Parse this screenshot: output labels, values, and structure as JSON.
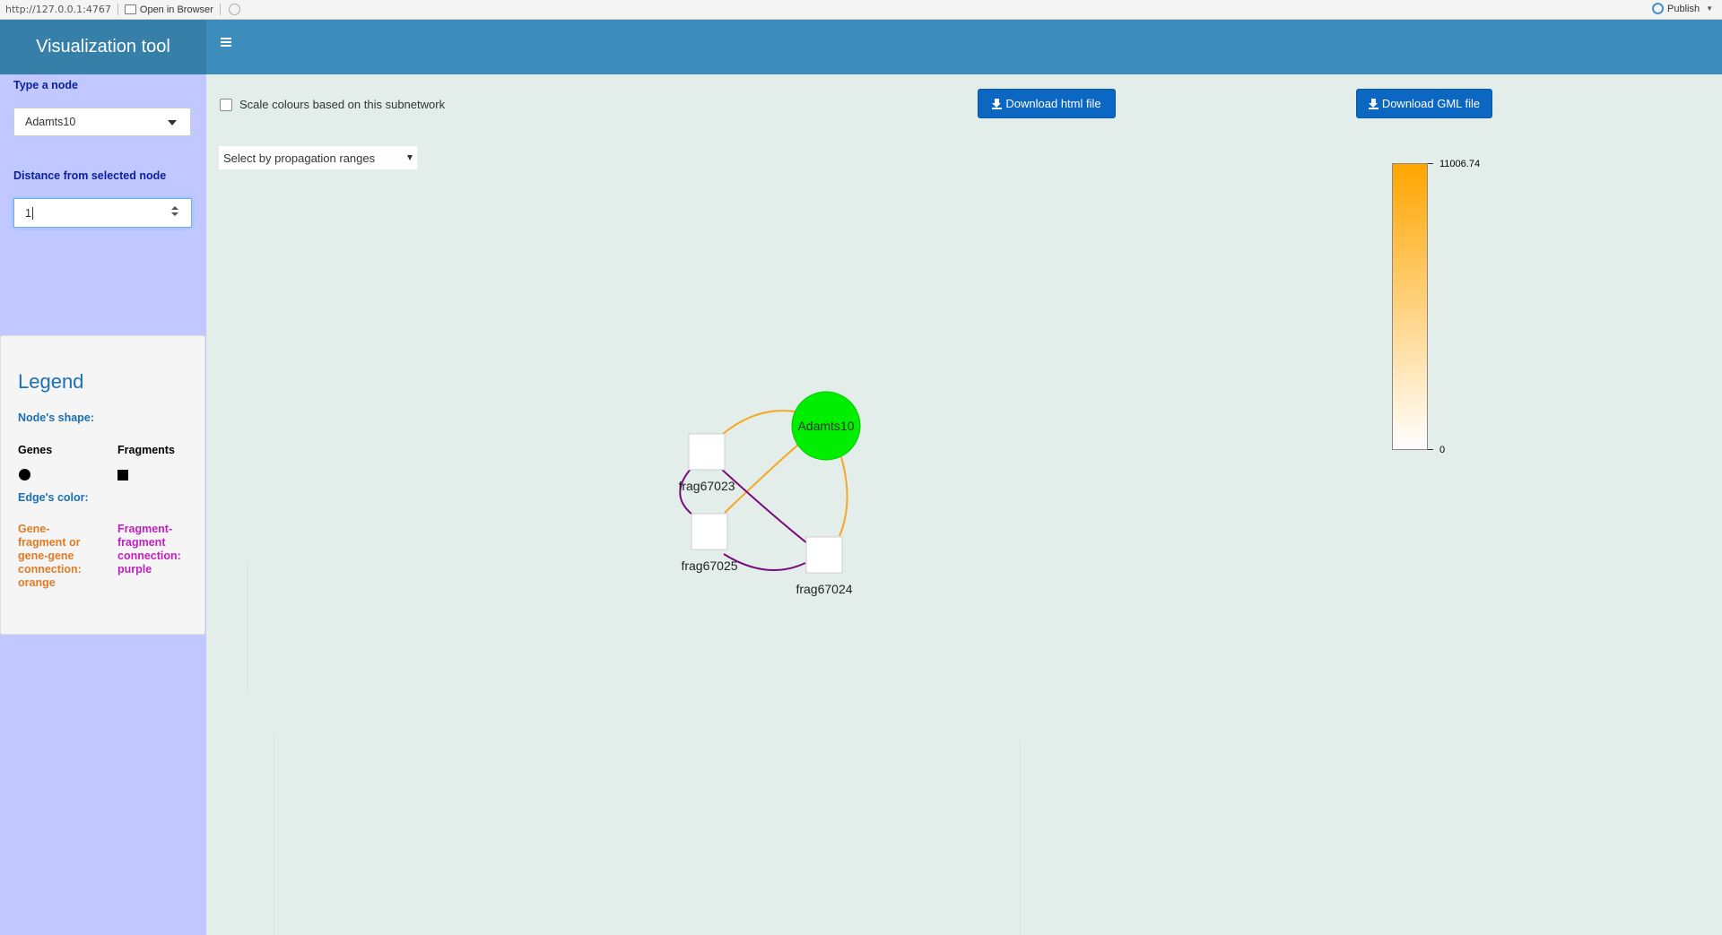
{
  "viewer": {
    "url": "http://127.0.0.1:4767",
    "open_in_browser": "Open in Browser",
    "publish": "Publish"
  },
  "header": {
    "title": "Visualization tool"
  },
  "sidebar": {
    "node_label": "Type a node",
    "node_value": "Adamts10",
    "distance_label": "Distance from selected node",
    "distance_value": "1"
  },
  "legend": {
    "title": "Legend",
    "shape_heading": "Node's shape:",
    "genes_label": "Genes",
    "fragments_label": "Fragments",
    "edge_heading": "Edge's color:",
    "gene_edge_text": "Gene-fragment or gene-gene connection: orange",
    "fragment_edge_text": "Fragment-fragment connection: purple",
    "gene_edge_color": "#e07b25",
    "fragment_edge_color": "#c21fc0"
  },
  "main": {
    "scale_checkbox_label": "Scale colours based on this subnetwork",
    "scale_checked": false,
    "download_html_label": "Download html file",
    "download_gml_label": "Download GML file",
    "range_select_placeholder": "Select by propagation ranges"
  },
  "colorbar": {
    "max_label": "11006.74",
    "min_label": "0",
    "high_color": "#ffa500",
    "low_color": "#ffffff"
  },
  "network": {
    "nodes": [
      {
        "id": "Adamts10",
        "type": "gene",
        "color": "#00ee00"
      },
      {
        "id": "frag67023",
        "type": "fragment",
        "color": "#ffffff"
      },
      {
        "id": "frag67025",
        "type": "fragment",
        "color": "#ffffff"
      },
      {
        "id": "frag67024",
        "type": "fragment",
        "color": "#ffffff"
      }
    ],
    "edges": [
      {
        "from": "frag67023",
        "to": "Adamts10",
        "color": "orange"
      },
      {
        "from": "frag67025",
        "to": "Adamts10",
        "color": "orange"
      },
      {
        "from": "frag67024",
        "to": "Adamts10",
        "color": "orange"
      },
      {
        "from": "frag67023",
        "to": "frag67024",
        "color": "purple"
      },
      {
        "from": "frag67023",
        "to": "frag67025",
        "color": "purple"
      },
      {
        "from": "frag67025",
        "to": "frag67024",
        "color": "purple"
      }
    ],
    "edge_colors": {
      "orange": "#f5a623",
      "purple": "#7b0a7d"
    }
  }
}
